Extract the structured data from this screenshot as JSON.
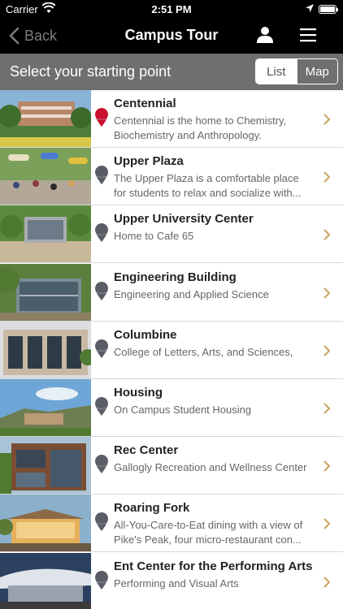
{
  "status_bar": {
    "carrier": "Carrier",
    "time": "2:51 PM",
    "icons": [
      "wifi-icon",
      "location-arrow-icon",
      "battery-icon"
    ]
  },
  "nav": {
    "back_label": "Back",
    "title": "Campus Tour",
    "icons": [
      "chevron-left-icon",
      "user-icon",
      "hamburger-menu-icon"
    ]
  },
  "toolbar": {
    "prompt": "Select your starting point",
    "view_options": [
      "List",
      "Map"
    ],
    "selected_view": "List"
  },
  "colors": {
    "selected_pin": "#c8102e",
    "pin": "#5a5d66",
    "chevron": "#c9a45c",
    "toolbar_bg": "#6f6f6f"
  },
  "locations": [
    {
      "name": "Centennial",
      "description": "Centennial is the home to Chemistry, Biochemistry and Anthropology.",
      "selected": true
    },
    {
      "name": "Upper Plaza",
      "description": "The Upper Plaza is a comfortable place for students to relax and socialize with...",
      "selected": false
    },
    {
      "name": "Upper University Center",
      "description": "Home to Cafe 65",
      "selected": false
    },
    {
      "name": "Engineering Building",
      "description": "Engineering and Applied Science",
      "selected": false
    },
    {
      "name": "Columbine",
      "description": "College of Letters, Arts, and Sciences,",
      "selected": false
    },
    {
      "name": "Housing",
      "description": "On Campus Student Housing",
      "selected": false
    },
    {
      "name": "Rec Center",
      "description": "Gallogly Recreation and Wellness Center",
      "selected": false
    },
    {
      "name": "Roaring Fork",
      "description": "All-You-Care-to-Eat dining with a view of Pike's Peak, four micro-restaurant con...",
      "selected": false
    },
    {
      "name": "Ent Center for the Performing Arts",
      "description": "Performing and Visual Arts",
      "selected": false
    }
  ]
}
